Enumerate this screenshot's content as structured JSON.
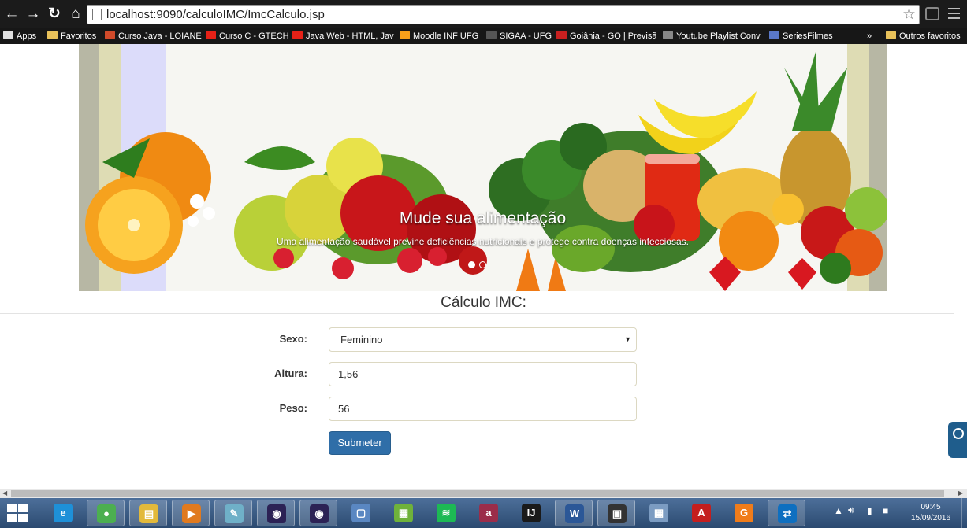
{
  "browser": {
    "url": "localhost:9090/calculoIMC/ImcCalculo.jsp",
    "bookmarks": [
      {
        "label": "Apps",
        "icon": "apps-grid-icon",
        "color": "#e0e0e0"
      },
      {
        "label": "Favoritos",
        "icon": "folder-icon",
        "color": "#e8c15a"
      },
      {
        "label": "Curso Java - LOIANE",
        "icon": "code-icon",
        "color": "#d04a2a"
      },
      {
        "label": "Curso C - GTECH",
        "icon": "youtube-icon",
        "color": "#e62117"
      },
      {
        "label": "Java Web - HTML, Jav",
        "icon": "youtube-icon",
        "color": "#e62117"
      },
      {
        "label": "Moodle INF UFG",
        "icon": "moodle-icon",
        "color": "#f7a01a"
      },
      {
        "label": "SIGAA - UFG",
        "icon": "page-icon",
        "color": "#555555"
      },
      {
        "label": "Goiânia - GO | Previsã",
        "icon": "weather-icon",
        "color": "#c82020"
      },
      {
        "label": "Youtube Playlist Conv",
        "icon": "music-icon",
        "color": "#888888"
      },
      {
        "label": "SeriesFilmes",
        "icon": "series-icon",
        "color": "#5a78c8"
      },
      {
        "label": "»",
        "icon": "",
        "color": ""
      },
      {
        "label": "Outros favoritos",
        "icon": "folder-icon",
        "color": "#e8c15a"
      }
    ]
  },
  "carousel": {
    "title": "Mude sua alimentação",
    "caption": "Uma alimentação saudável previne deficiências nutricionais e protege contra doenças infecciosas.",
    "slide_count": 2,
    "active_slide": 1
  },
  "form": {
    "title": "Cálculo IMC:",
    "sexo_label": "Sexo:",
    "sexo_value": "Feminino",
    "altura_label": "Altura:",
    "altura_value": "1,56",
    "peso_label": "Peso:",
    "peso_value": "56",
    "submit_label": "Submeter"
  },
  "taskbar": {
    "apps": [
      {
        "name": "internet-explorer",
        "glyph": "e",
        "color": "#1e90d8",
        "open": false
      },
      {
        "name": "chrome",
        "glyph": "●",
        "color": "#4caf50",
        "open": true
      },
      {
        "name": "file-explorer",
        "glyph": "▤",
        "color": "#e2b93b",
        "open": true
      },
      {
        "name": "media-player",
        "glyph": "▶",
        "color": "#e07a1f",
        "open": true
      },
      {
        "name": "notepad",
        "glyph": "✎",
        "color": "#6fb0c8",
        "open": true
      },
      {
        "name": "eclipse",
        "glyph": "◉",
        "color": "#2c2255",
        "open": true
      },
      {
        "name": "eclipse-2",
        "glyph": "◉",
        "color": "#2c2255",
        "open": true
      },
      {
        "name": "virtualbox",
        "glyph": "▢",
        "color": "#5a87c2",
        "open": false
      },
      {
        "name": "microsoft-store",
        "glyph": "▦",
        "color": "#6fb23a",
        "open": false
      },
      {
        "name": "spotify",
        "glyph": "≋",
        "color": "#1db954",
        "open": false
      },
      {
        "name": "astah",
        "glyph": "a",
        "color": "#9b2d4a",
        "open": false
      },
      {
        "name": "intellij",
        "glyph": "IJ",
        "color": "#1a1a1a",
        "open": false
      },
      {
        "name": "word",
        "glyph": "W",
        "color": "#2b5797",
        "open": true
      },
      {
        "name": "console",
        "glyph": "▣",
        "color": "#333333",
        "open": true
      },
      {
        "name": "calculator",
        "glyph": "▦",
        "color": "#7c9cc2",
        "open": false
      },
      {
        "name": "acrobat",
        "glyph": "A",
        "color": "#c41e1e",
        "open": false
      },
      {
        "name": "foxit-pdf",
        "glyph": "G",
        "color": "#f07c1a",
        "open": false
      },
      {
        "name": "teamviewer",
        "glyph": "⇄",
        "color": "#0e6fc0",
        "open": true
      }
    ],
    "clock_time": "09:45",
    "clock_date": "15/09/2016"
  }
}
